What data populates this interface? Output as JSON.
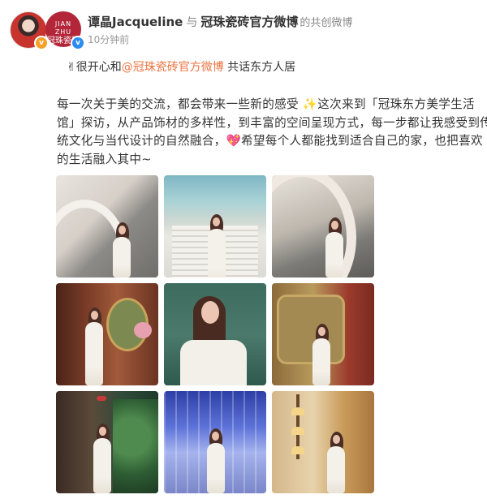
{
  "post": {
    "author": "谭晶Jacqueline",
    "separator": "与",
    "coauthor": "冠珠瓷砖官方微博",
    "co_label": "的共创微博",
    "time": "10分钟前",
    "avatar_brand_text_1": "JIAN ZHU",
    "avatar_brand_text_2": "冠珠瓷砖",
    "line1_prefix": "✌很开心和",
    "line1_mention": "@冠珠瓷砖官方微博",
    "line1_suffix": " 共话东方人居",
    "para_lines": [
      "每一次关于美的交流，都会带来一些新的感受 ✨这次来到「冠珠东方美学生活",
      "馆」探访，从产品饰材的多样性，到丰富的空间呈现方式，每一步都让我感受到传",
      "统文化与当代设计的自然融合，💖希望每个人都能找到适合自己的家，也把喜欢",
      "的生活融入其中~"
    ]
  },
  "colors": {
    "mention": "#eb7340",
    "text": "#333333",
    "muted": "#999999",
    "brand_red": "#b3263a",
    "verified_blue": "#2d8cf0",
    "verified_orange": "#f7a12a"
  },
  "photos": [
    {
      "name": "photo-1-spiral-staircase"
    },
    {
      "name": "photo-2-grand-staircase"
    },
    {
      "name": "photo-3-spiral-staircase"
    },
    {
      "name": "photo-4-wood-panel-room"
    },
    {
      "name": "photo-5-green-wall-portrait"
    },
    {
      "name": "photo-6-golden-screen"
    },
    {
      "name": "photo-7-garden-room"
    },
    {
      "name": "photo-8-blue-lights"
    },
    {
      "name": "photo-9-golden-lamps"
    }
  ]
}
